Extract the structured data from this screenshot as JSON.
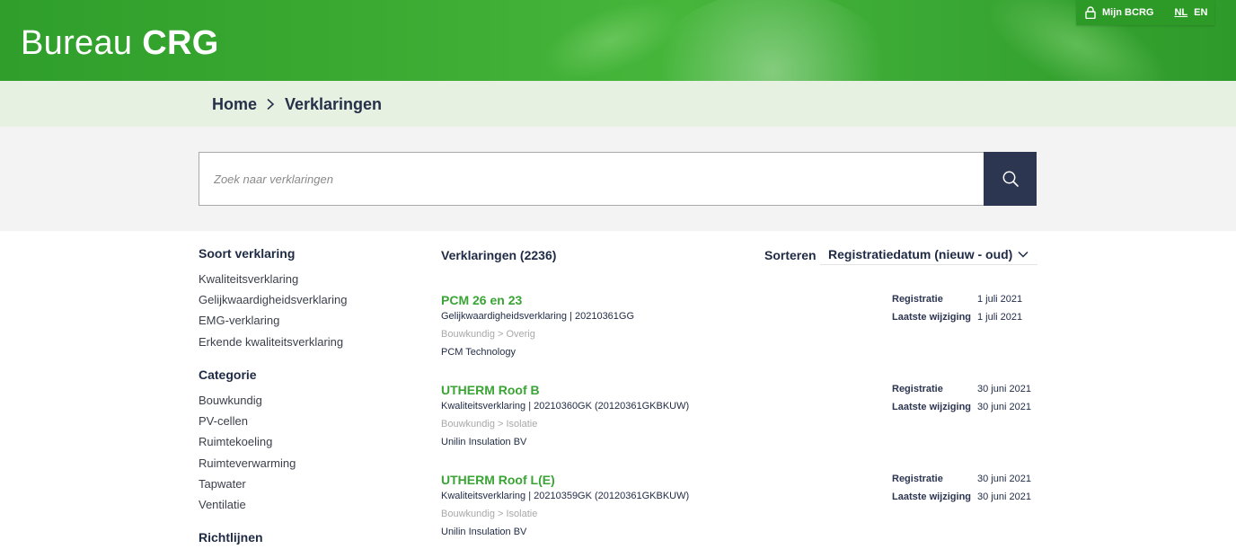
{
  "header": {
    "logo_light": "Bureau",
    "logo_bold": "CRG",
    "account_label": "Mijn BCRG",
    "lang_nl": "NL",
    "lang_en": "EN"
  },
  "breadcrumb": {
    "home": "Home",
    "current": "Verklaringen"
  },
  "search": {
    "placeholder": "Zoek naar verklaringen"
  },
  "sidebar": {
    "sections": [
      {
        "title": "Soort verklaring",
        "items": [
          "Kwaliteitsverklaring",
          "Gelijkwaardigheidsverklaring",
          "EMG-verklaring",
          "Erkende kwaliteitsverklaring"
        ]
      },
      {
        "title": "Categorie",
        "items": [
          "Bouwkundig",
          "PV-cellen",
          "Ruimtekoeling",
          "Ruimteverwarming",
          "Tapwater",
          "Ventilatie"
        ]
      },
      {
        "title": "Richtlijnen",
        "items": []
      }
    ]
  },
  "results": {
    "title": "Verklaringen (2236)",
    "sort_label": "Sorteren",
    "sort_value": "Registratiedatum (nieuw - oud)",
    "registratie_label": "Registratie",
    "wijziging_label": "Laatste wijziging",
    "items": [
      {
        "title": "PCM 26 en 23",
        "type_line": "Gelijkwaardigheidsverklaring | 20210361GG",
        "category": "Bouwkundig > Overig",
        "company": "PCM Technology",
        "registratie": "1 juli 2021",
        "wijziging": "1 juli 2021"
      },
      {
        "title": "UTHERM Roof B",
        "type_line": "Kwaliteitsverklaring | 20210360GK (20120361GKBKUW)",
        "category": "Bouwkundig > Isolatie",
        "company": "Unilin Insulation BV",
        "registratie": "30 juni 2021",
        "wijziging": "30 juni 2021"
      },
      {
        "title": "UTHERM Roof L(E)",
        "type_line": "Kwaliteitsverklaring | 20210359GK (20120361GKBKUW)",
        "category": "Bouwkundig > Isolatie",
        "company": "Unilin Insulation BV",
        "registratie": "30 juni 2021",
        "wijziging": "30 juni 2021"
      }
    ]
  },
  "colors": {
    "brand_green": "#3aa535",
    "header_green": "#3aaa32",
    "navy": "#2d3650",
    "breadcrumb_bg": "#e6f1e2"
  },
  "icons": {
    "account": "lock-icon",
    "breadcrumb_separator": "chevron-right-icon",
    "search": "search-icon",
    "sort": "chevron-down-icon"
  }
}
